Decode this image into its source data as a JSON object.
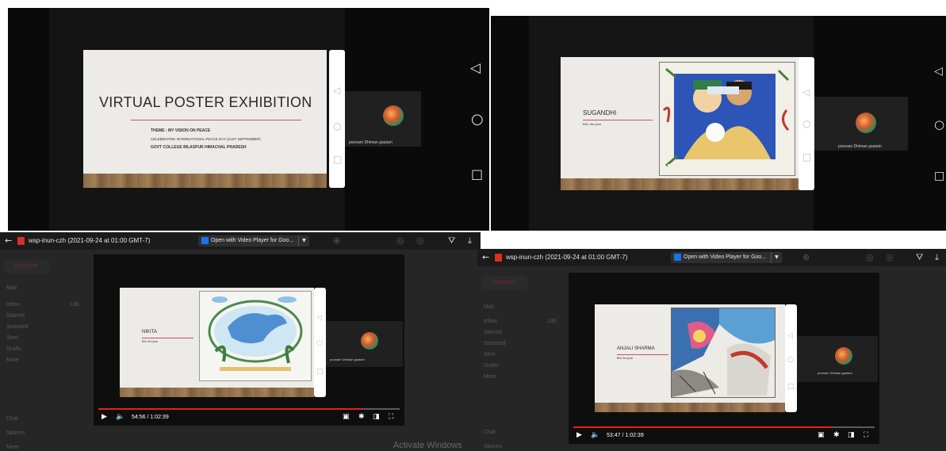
{
  "panels": {
    "p1": {
      "slide_title": "VIRTUAL POSTER EXHIBITION",
      "theme_line": "THEME : MY VISION ON PEACE",
      "celebrating_line": "CELEBRATING INTERNATIONAL PEACE DAY (21ST SEPTEMBER)",
      "college_line": "GOVT COLLEGE BILASPUR HIMACHAL PRADESH",
      "participant_name": "poonam Dhiman gautam"
    },
    "p2": {
      "student_name": "SUGANDHI",
      "student_class": "BSc 3rd year",
      "participant_name": "poonam Dhiman gautam"
    },
    "p3": {
      "file_name": "wsp-inun-czh (2021-09-24 at 01:00 GMT-7)",
      "open_with_label": "Open with Video Player for Goo...",
      "student_name": "NIKITA",
      "student_class": "BSc 3rd year",
      "participant_name": "poonam Dhiman gautam",
      "time": "54:56 / 1:02:39",
      "progress": 0.877,
      "watermark": "Activate Windows",
      "gmail": {
        "compose": "Compose",
        "mail": "Mail",
        "inbox": "Inbox",
        "inbox_count": "136",
        "starred": "Starred",
        "snoozed": "Snoozed",
        "sent": "Sent",
        "drafts": "Drafts",
        "more": "More",
        "chat": "Chat",
        "spaces": "Spaces",
        "meet": "Meet"
      }
    },
    "p4": {
      "file_name": "wsp-inun-czh (2021-09-24 at 01:00 GMT-7)",
      "open_with_label": "Open with Video Player for Goo...",
      "student_name": "ANJALI SHARMA",
      "student_class": "BSc 3rd year",
      "participant_name": "poonam Dhiman gautam",
      "time": "53:47 / 1:02:39",
      "progress": 0.858,
      "gmail": {
        "compose": "Compose",
        "mail": "Mail",
        "inbox": "Inbox",
        "inbox_count": "136",
        "starred": "Starred",
        "snoozed": "Snoozed",
        "sent": "Sent",
        "drafts": "Drafts",
        "more": "More",
        "chat": "Chat",
        "spaces": "Spaces"
      }
    }
  },
  "colors": {
    "accent_red": "#e62117",
    "slide_bg": "#ecebe8",
    "title_rule": "#c7505a",
    "drive_bg": "#262626"
  }
}
